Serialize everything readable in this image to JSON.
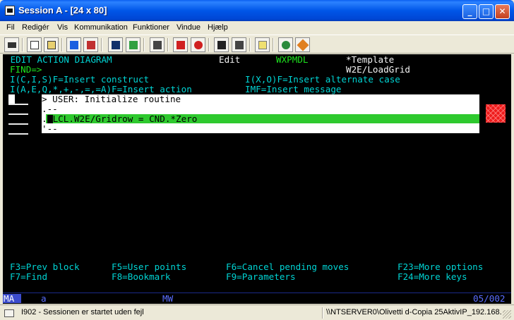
{
  "window": {
    "title": "Session A - [24 x 80]",
    "controls": {
      "minimize": "_",
      "maximize": "□",
      "close": "✕"
    }
  },
  "menu": [
    "Fil",
    "Redigér",
    "Vis",
    "Kommunikation",
    "Funktioner",
    "Vindue",
    "Hjælp"
  ],
  "toolbar": {
    "buttons": [
      "print-icon",
      "copy-icon",
      "paste-icon",
      "send-icon",
      "receive-icon",
      "display-icon",
      "keyboard-icon",
      "macro-record-icon",
      "macro-stop-icon",
      "macro-play-icon",
      "macro-pause-icon",
      "clipboard-icon",
      "globe-icon",
      "help-icon"
    ]
  },
  "terminal": {
    "header": {
      "title": " EDIT ACTION DIAGRAM",
      "mode": "Edit",
      "program": "WXPMDL",
      "template": "*Template",
      "function": "W2E/LoadGrid",
      "find_label": "FIND=>"
    },
    "help_lines": [
      "I(C,I,S)F=Insert construct",
      "I(X,O)F=Insert alternate case",
      "I(A,E,Q,*,+,-,=,=A)F=Insert action",
      "IMF=Insert message"
    ],
    "popup": {
      "line1": "> USER: Initialize routine",
      "line2": ".--",
      "line3_prefix": ".",
      "line3_text": "LCL.W2E/Gridrow = CND.*Zero",
      "line4": "'--"
    },
    "function_keys": [
      "F3=Prev block",
      "F5=User points",
      "F6=Cancel pending moves",
      "F23=More options",
      "F7=Find",
      "F8=Bookmark",
      "F9=Parameters",
      "F24=More keys"
    ],
    "oia": {
      "ma": "MA",
      "indicator": "a",
      "mw": "MW",
      "cursor_pos": "05/002"
    }
  },
  "status": {
    "message": "I902 - Sessionen er startet uden fejl",
    "host": "\\\\NTSERVER0\\Olivetti d-Copia 25AktivIP_192.168."
  },
  "colors": {
    "title_bar": "#0054e3",
    "terminal_bg": "#000000",
    "cyan": "#00d4d4",
    "green": "#1ee61e",
    "highlight": "#2ec92e",
    "oia_blue": "#5a6eff",
    "error_red": "#ee1c1c"
  }
}
